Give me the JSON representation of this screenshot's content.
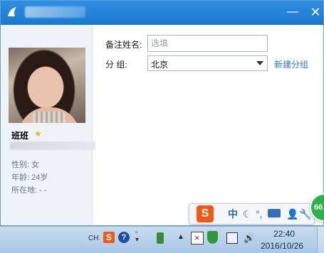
{
  "window": {
    "minimize_icon": "minimize-icon",
    "close_icon": "close-icon"
  },
  "profile": {
    "nickname": "班班",
    "gender": "性别: 女",
    "age": "年龄: 24岁",
    "location": "所在地:  -    -"
  },
  "form": {
    "remark_label": "备注姓名:",
    "remark_placeholder": "选填",
    "remark_value": "",
    "group_label": "分    组:",
    "group_value": "北京",
    "new_group_link": "新建分组"
  },
  "ime": {
    "logo": "S",
    "mode": "中",
    "moon": "☾",
    "punct": "°,",
    "user": "👤",
    "wrench": "🔧"
  },
  "badge": {
    "text": "66"
  },
  "taskbar": {
    "lang": "CH",
    "sogou": "S",
    "help": "?",
    "chevron": "▲",
    "volume": "🔊",
    "time": "22:40",
    "date": "2016/10/26"
  },
  "colors": {
    "titlebar": "#1b78cf",
    "link": "#2a7ac4",
    "ime_logo": "#f05a16",
    "badge": "#2fb14a"
  }
}
